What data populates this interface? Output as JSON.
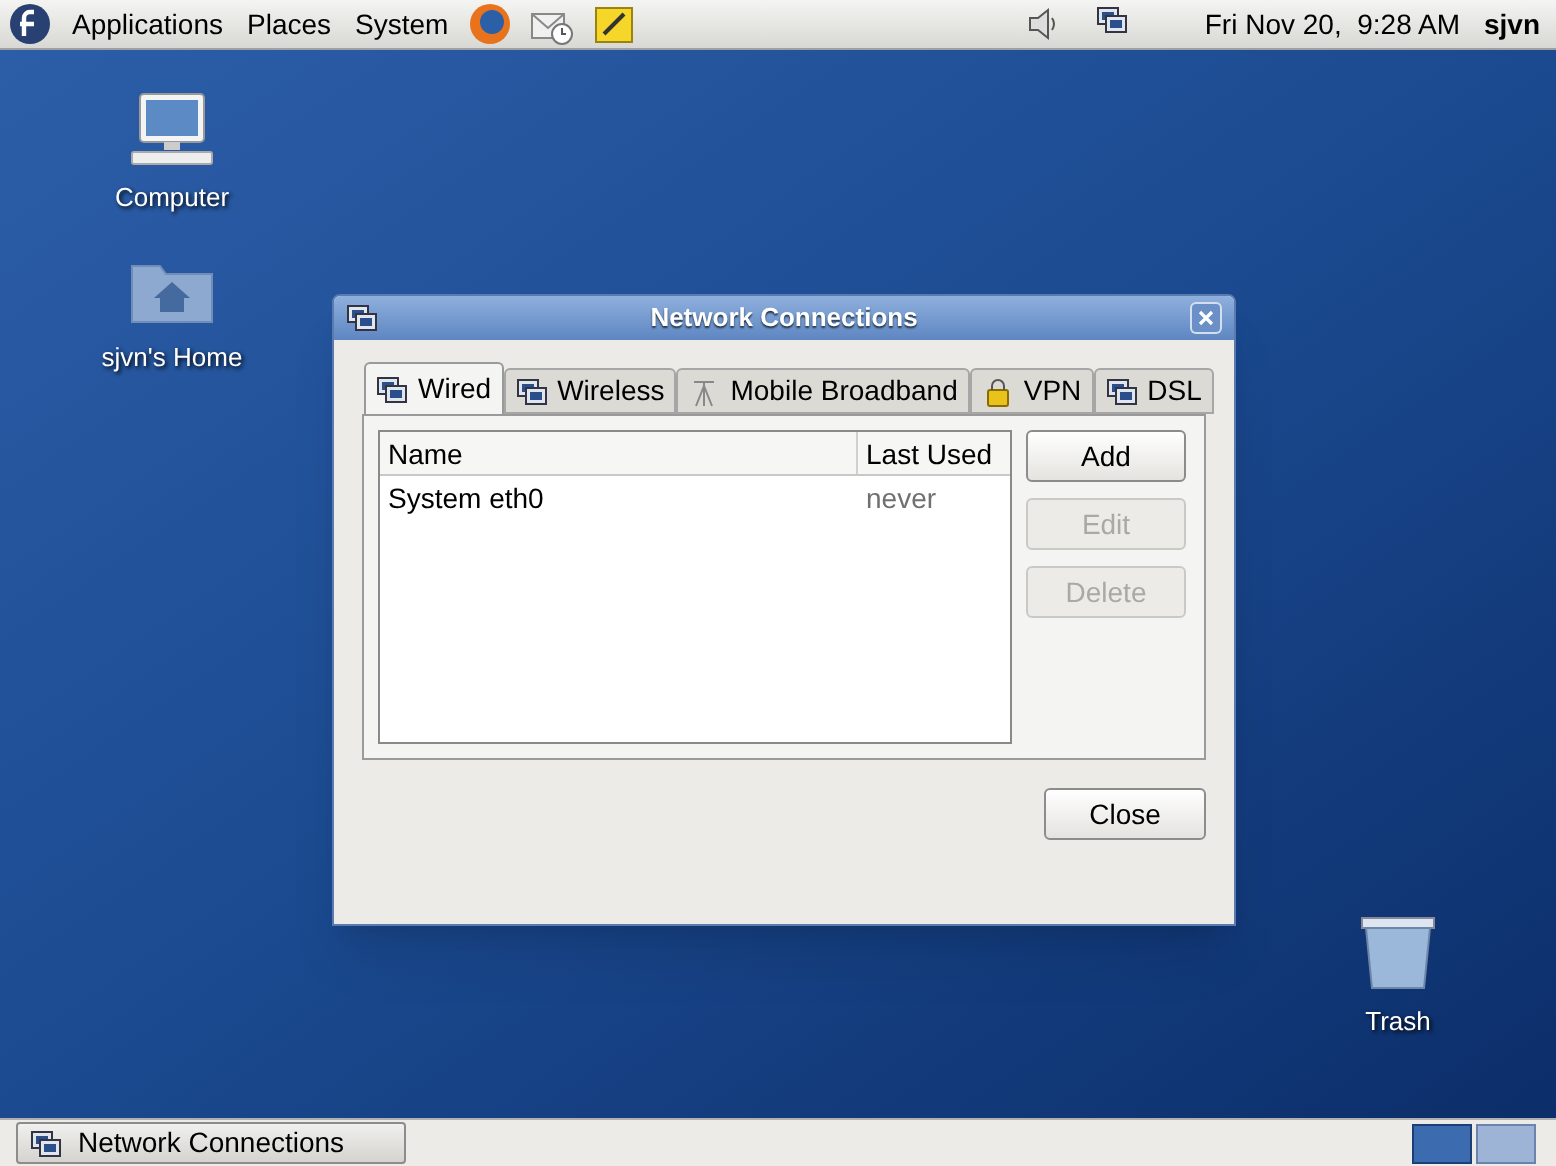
{
  "top_panel": {
    "menus": [
      "Applications",
      "Places",
      "System"
    ],
    "clock": "Fri Nov 20,  9:28 AM",
    "user": "sjvn"
  },
  "desktop_icons": [
    {
      "label": "Computer",
      "kind": "computer"
    },
    {
      "label": "sjvn's Home",
      "kind": "home"
    },
    {
      "label": "Trash",
      "kind": "trash"
    }
  ],
  "dialog": {
    "title": "Network Connections",
    "tabs": [
      {
        "label": "Wired",
        "kind": "wired",
        "selected": true
      },
      {
        "label": "Wireless",
        "kind": "wired",
        "selected": false
      },
      {
        "label": "Mobile Broadband",
        "kind": "antenna",
        "selected": false
      },
      {
        "label": "VPN",
        "kind": "lock",
        "selected": false
      },
      {
        "label": "DSL",
        "kind": "wired",
        "selected": false
      }
    ],
    "table": {
      "columns": [
        "Name",
        "Last Used"
      ],
      "rows": [
        {
          "name": "System eth0",
          "last_used": "never"
        }
      ]
    },
    "buttons": [
      {
        "label": "Add",
        "disabled": false
      },
      {
        "label": "Edit",
        "disabled": true
      },
      {
        "label": "Delete",
        "disabled": true
      }
    ],
    "close_button": "Close"
  },
  "taskbar": {
    "windows": [
      {
        "label": "Network Connections"
      }
    ],
    "workspaces": [
      {
        "selected": true
      },
      {
        "selected": false
      }
    ]
  }
}
